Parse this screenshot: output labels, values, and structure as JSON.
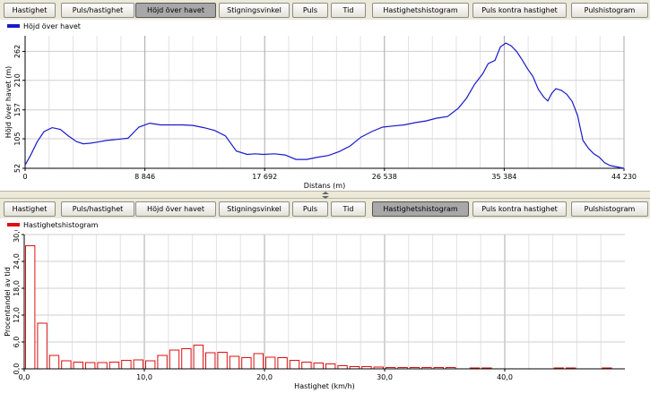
{
  "tabs": [
    {
      "label": "Hastighet"
    },
    {
      "label": "Puls/hastighet"
    },
    {
      "label": "Höjd över havet"
    },
    {
      "label": "Stigningsvinkel"
    },
    {
      "label": "Puls"
    },
    {
      "label": "Tid"
    },
    {
      "label": "Hastighetshistogram"
    },
    {
      "label": "Puls kontra hastighet"
    },
    {
      "label": "Pulshistogram"
    }
  ],
  "top_panel": {
    "active_tab": "Höjd över havet",
    "legend": "Höjd över havet",
    "series_color": "#1a1acc"
  },
  "bottom_panel": {
    "active_tab": "Hastighetshistogram",
    "legend": "Hastighetshistogram",
    "series_color": "#dd1111"
  },
  "chart_data": [
    {
      "type": "line",
      "series": [
        {
          "name": "Höjd över havet"
        }
      ],
      "xlabel": "Distans (m)",
      "ylabel": "Höjd över havet (m)",
      "xlim": [
        0,
        44230
      ],
      "ylim": [
        52,
        290
      ],
      "x_ticks": [
        "0",
        "8 846",
        "17 692",
        "26 538",
        "35 384",
        "44 230"
      ],
      "y_ticks": [
        "52",
        "105",
        "157",
        "210",
        "262"
      ],
      "grid": true,
      "x": [
        0,
        400,
        900,
        1400,
        2000,
        2600,
        3200,
        3800,
        4300,
        4800,
        5300,
        6000,
        6800,
        7600,
        8400,
        9200,
        10000,
        10800,
        11600,
        12400,
        13200,
        14000,
        14800,
        15600,
        16400,
        17000,
        17600,
        18400,
        19200,
        20000,
        20800,
        21600,
        22400,
        23200,
        24000,
        24800,
        25600,
        26400,
        27200,
        28000,
        28800,
        29600,
        30400,
        31200,
        32000,
        32600,
        33200,
        33800,
        34200,
        34700,
        35100,
        35500,
        35900,
        36300,
        36700,
        37100,
        37500,
        37900,
        38300,
        38600,
        38900,
        39200,
        39600,
        40000,
        40400,
        40800,
        41200,
        41600,
        42000,
        42400,
        42800,
        43200,
        43600,
        44230
      ],
      "values": [
        58,
        75,
        100,
        118,
        125,
        122,
        110,
        100,
        96,
        97,
        99,
        102,
        104,
        106,
        126,
        133,
        130,
        130,
        130,
        129,
        125,
        120,
        110,
        83,
        77,
        78,
        77,
        78,
        76,
        68,
        68,
        72,
        75,
        82,
        92,
        108,
        118,
        126,
        128,
        130,
        134,
        137,
        142,
        145,
        160,
        178,
        203,
        222,
        240,
        246,
        270,
        277,
        272,
        262,
        247,
        231,
        217,
        194,
        180,
        173,
        187,
        195,
        192,
        185,
        172,
        147,
        102,
        88,
        78,
        72,
        62,
        57,
        55,
        52
      ]
    },
    {
      "type": "bar",
      "series": [
        {
          "name": "Hastighetshistogram"
        }
      ],
      "xlabel": "Hastighet (km/h)",
      "ylabel": "Procentandel av tid",
      "xlim": [
        0,
        50
      ],
      "ylim": [
        0,
        30
      ],
      "x_ticks": [
        "0,0",
        "10,0",
        "20,0",
        "30,0",
        "40,0"
      ],
      "y_ticks": [
        "0,0",
        "6,0",
        "12,0",
        "18,0",
        "24,0",
        "30,0"
      ],
      "grid": true,
      "bin_width": 1,
      "x": [
        0,
        1,
        2,
        3,
        4,
        5,
        6,
        7,
        8,
        9,
        10,
        11,
        12,
        13,
        14,
        15,
        16,
        17,
        18,
        19,
        20,
        21,
        22,
        23,
        24,
        25,
        26,
        27,
        28,
        29,
        30,
        31,
        32,
        33,
        34,
        35,
        37,
        38,
        44,
        45,
        48
      ],
      "values": [
        27.5,
        10.2,
        3.0,
        1.8,
        1.5,
        1.4,
        1.4,
        1.5,
        1.9,
        2.0,
        1.8,
        3.0,
        4.2,
        4.5,
        5.3,
        3.6,
        3.7,
        2.8,
        2.5,
        3.4,
        2.6,
        2.5,
        1.9,
        1.5,
        1.3,
        1.1,
        0.7,
        0.5,
        0.5,
        0.4,
        0.3,
        0.3,
        0.3,
        0.3,
        0.3,
        0.3,
        0.2,
        0.2,
        0.2,
        0.2,
        0.2
      ]
    }
  ]
}
